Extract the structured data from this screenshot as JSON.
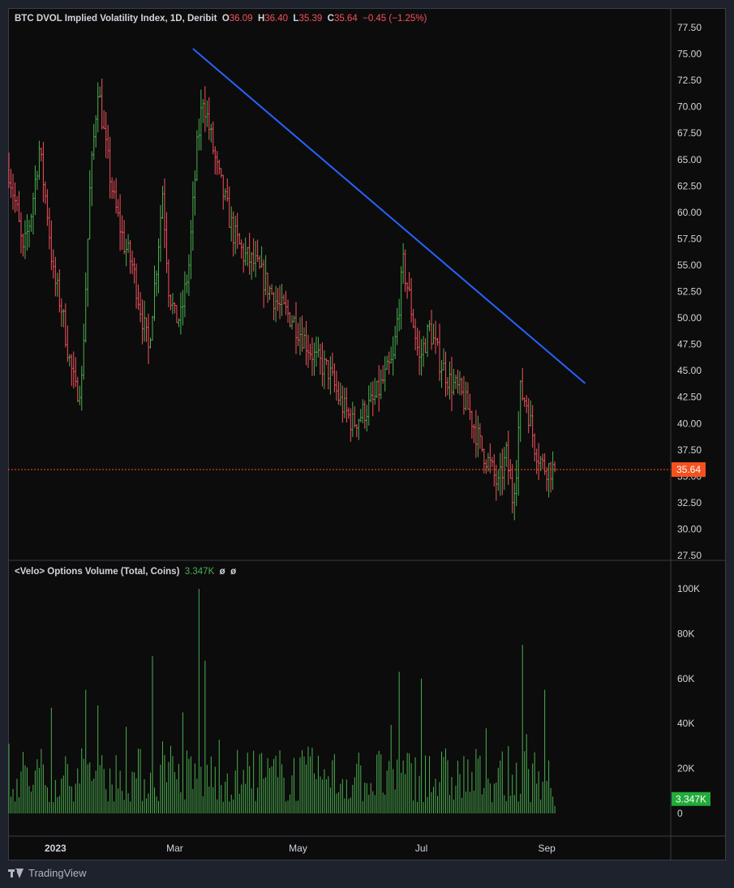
{
  "legend": {
    "title": "BTC DVOL Implied Volatility Index, 1D, Deribit",
    "o_key": "O",
    "o_val": "36.09",
    "h_key": "H",
    "h_val": "36.40",
    "l_key": "L",
    "l_val": "35.39",
    "c_key": "C",
    "c_val": "35.64",
    "change": "−0.45 (−1.25%)"
  },
  "volume_legend": {
    "title": "<Velo> Options Volume (Total, Coins)",
    "value": "3.347K",
    "extra1": "ø",
    "extra2": "ø"
  },
  "footer": {
    "brand": "TradingView"
  },
  "colors": {
    "up": "#4caf50",
    "down": "#f7525f",
    "trendline": "#2962ff",
    "price_label_bg": "#f4511e",
    "volume": "#4caf50"
  },
  "chart_data": [
    {
      "type": "ohlc",
      "title": "BTC DVOL Implied Volatility Index, 1D, Deribit",
      "x_axis_labels": [
        "2023",
        "Mar",
        "May",
        "Jul",
        "Sep"
      ],
      "x_axis_dates": [
        "2023-01-01",
        "2023-03-01",
        "2023-05-01",
        "2023-07-01",
        "2023-09-01"
      ],
      "y_axis_ticks": [
        "27.50",
        "30.00",
        "32.50",
        "35.00",
        "37.50",
        "40.00",
        "42.50",
        "45.00",
        "47.50",
        "50.00",
        "52.50",
        "55.00",
        "57.50",
        "60.00",
        "62.50",
        "65.00",
        "67.50",
        "70.00",
        "72.50",
        "75.00",
        "77.50"
      ],
      "ylim": [
        27.5,
        77.5
      ],
      "date_range": [
        "2022-12-09",
        "2023-09-05"
      ],
      "close_path": [
        [
          "2022-12-09",
          64
        ],
        [
          "2022-12-13",
          60
        ],
        [
          "2022-12-16",
          56
        ],
        [
          "2022-12-20",
          60
        ],
        [
          "2022-12-24",
          66
        ],
        [
          "2022-12-28",
          60
        ],
        [
          "2022-12-31",
          54
        ],
        [
          "2023-01-04",
          51
        ],
        [
          "2023-01-08",
          46
        ],
        [
          "2023-01-11",
          43
        ],
        [
          "2023-01-14",
          44
        ],
        [
          "2023-01-18",
          62
        ],
        [
          "2023-01-22",
          72
        ],
        [
          "2023-01-26",
          66
        ],
        [
          "2023-01-30",
          61
        ],
        [
          "2023-02-04",
          57
        ],
        [
          "2023-02-08",
          55
        ],
        [
          "2023-02-12",
          51
        ],
        [
          "2023-02-16",
          47
        ],
        [
          "2023-02-20",
          55
        ],
        [
          "2023-02-23",
          62
        ],
        [
          "2023-02-26",
          53
        ],
        [
          "2023-03-01",
          50
        ],
        [
          "2023-03-04",
          50
        ],
        [
          "2023-03-08",
          55
        ],
        [
          "2023-03-12",
          66
        ],
        [
          "2023-03-15",
          71
        ],
        [
          "2023-03-18",
          68
        ],
        [
          "2023-03-22",
          64
        ],
        [
          "2023-03-26",
          61
        ],
        [
          "2023-03-30",
          58
        ],
        [
          "2023-04-04",
          56
        ],
        [
          "2023-04-10",
          55
        ],
        [
          "2023-04-16",
          53
        ],
        [
          "2023-04-22",
          51
        ],
        [
          "2023-04-28",
          50
        ],
        [
          "2023-05-04",
          48
        ],
        [
          "2023-05-10",
          46
        ],
        [
          "2023-05-16",
          45
        ],
        [
          "2023-05-22",
          42
        ],
        [
          "2023-05-28",
          40
        ],
        [
          "2023-06-02",
          41
        ],
        [
          "2023-06-07",
          42
        ],
        [
          "2023-06-12",
          44
        ],
        [
          "2023-06-17",
          46
        ],
        [
          "2023-06-22",
          55
        ],
        [
          "2023-06-25",
          52
        ],
        [
          "2023-06-30",
          46
        ],
        [
          "2023-07-05",
          49
        ],
        [
          "2023-07-10",
          46
        ],
        [
          "2023-07-15",
          44
        ],
        [
          "2023-07-20",
          43
        ],
        [
          "2023-07-25",
          41
        ],
        [
          "2023-07-30",
          38
        ],
        [
          "2023-08-04",
          36
        ],
        [
          "2023-08-08",
          34
        ],
        [
          "2023-08-12",
          37
        ],
        [
          "2023-08-15",
          33
        ],
        [
          "2023-08-17",
          36
        ],
        [
          "2023-08-19",
          43
        ],
        [
          "2023-08-22",
          42
        ],
        [
          "2023-08-26",
          38
        ],
        [
          "2023-08-30",
          36
        ],
        [
          "2023-09-05",
          35.64
        ]
      ],
      "last": {
        "open": 36.09,
        "high": 36.4,
        "low": 35.39,
        "close": 35.64,
        "change": -0.45,
        "change_pct": -1.25
      },
      "last_price_label": "35.64",
      "trendline": {
        "from": [
          "2023-03-10",
          75.5
        ],
        "to": [
          "2023-09-20",
          43.8
        ]
      }
    },
    {
      "type": "bar",
      "title": "<Velo> Options Volume (Total, Coins)",
      "y_axis_ticks": [
        "0",
        "20K",
        "40K",
        "60K",
        "80K",
        "100K"
      ],
      "ylim": [
        0,
        100000
      ],
      "date_range": [
        "2022-12-09",
        "2023-09-05"
      ],
      "typical_range": [
        5000,
        30000
      ],
      "spikes": [
        [
          "2022-12-30",
          47000
        ],
        [
          "2023-01-16",
          55000
        ],
        [
          "2023-01-22",
          48000
        ],
        [
          "2023-02-18",
          70000
        ],
        [
          "2023-03-05",
          45000
        ],
        [
          "2023-03-13",
          100000
        ],
        [
          "2023-03-16",
          68000
        ],
        [
          "2023-06-20",
          63000
        ],
        [
          "2023-07-01",
          60000
        ],
        [
          "2023-08-20",
          75000
        ],
        [
          "2023-08-31",
          55000
        ]
      ],
      "last_value_label": "3.347K"
    }
  ]
}
